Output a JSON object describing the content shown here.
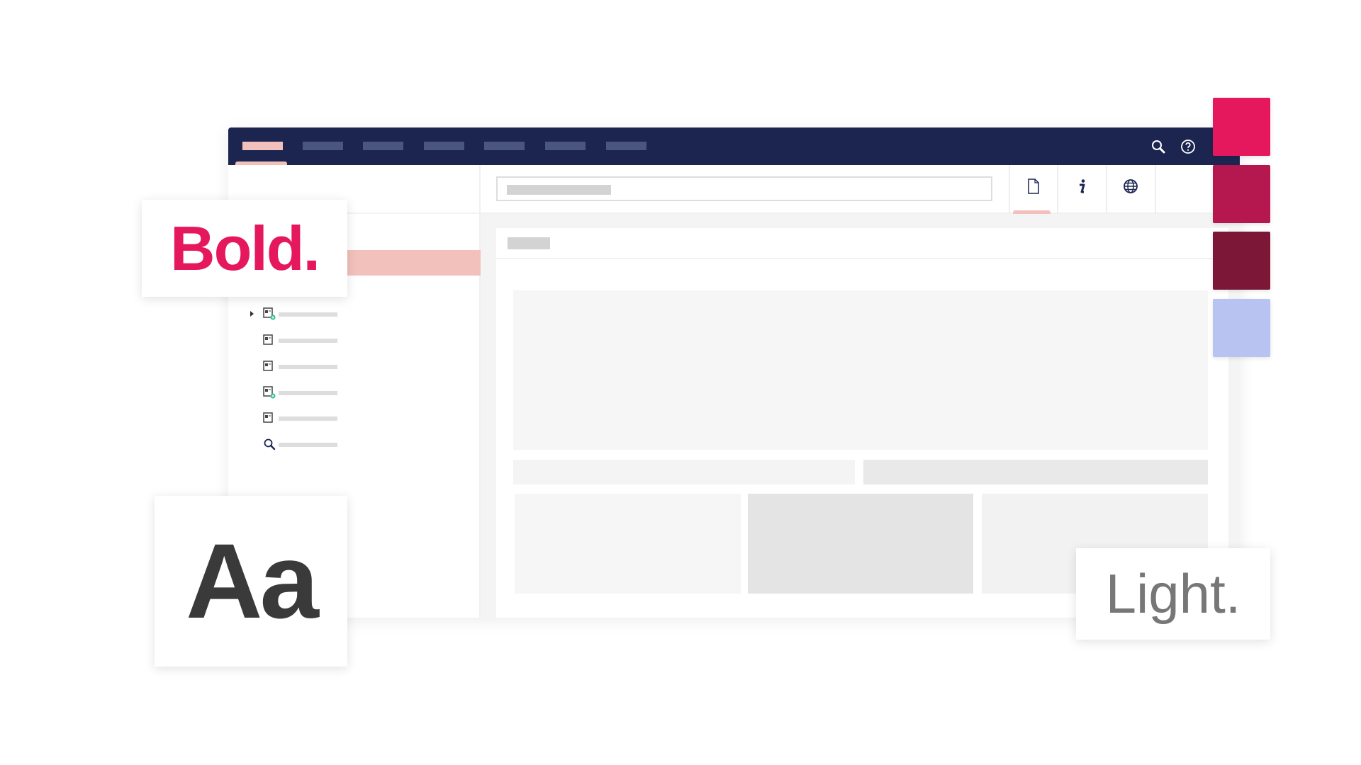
{
  "nav": {
    "tabs": [
      {
        "active": true
      },
      {},
      {},
      {},
      {},
      {},
      {}
    ],
    "icons": [
      "search-icon",
      "help-icon"
    ]
  },
  "toolbar": {
    "icons": [
      "file-icon",
      "info-icon",
      "globe-icon"
    ],
    "active_icon": "file-icon"
  },
  "sidebar": {
    "tree_icons": [
      "document-add-icon",
      "document-icon",
      "document-icon",
      "document-add-icon",
      "document-icon",
      "search-icon"
    ]
  },
  "cards": {
    "bold": "Bold.",
    "aa": "Aa",
    "light": "Light."
  },
  "colors": {
    "nav": "#1b2550",
    "accent_soft": "#f2c1bb",
    "bold_text": "#e5185e",
    "swatches": [
      "#e5185e",
      "#b5184f",
      "#7d1738",
      "#b8c3f2"
    ]
  }
}
